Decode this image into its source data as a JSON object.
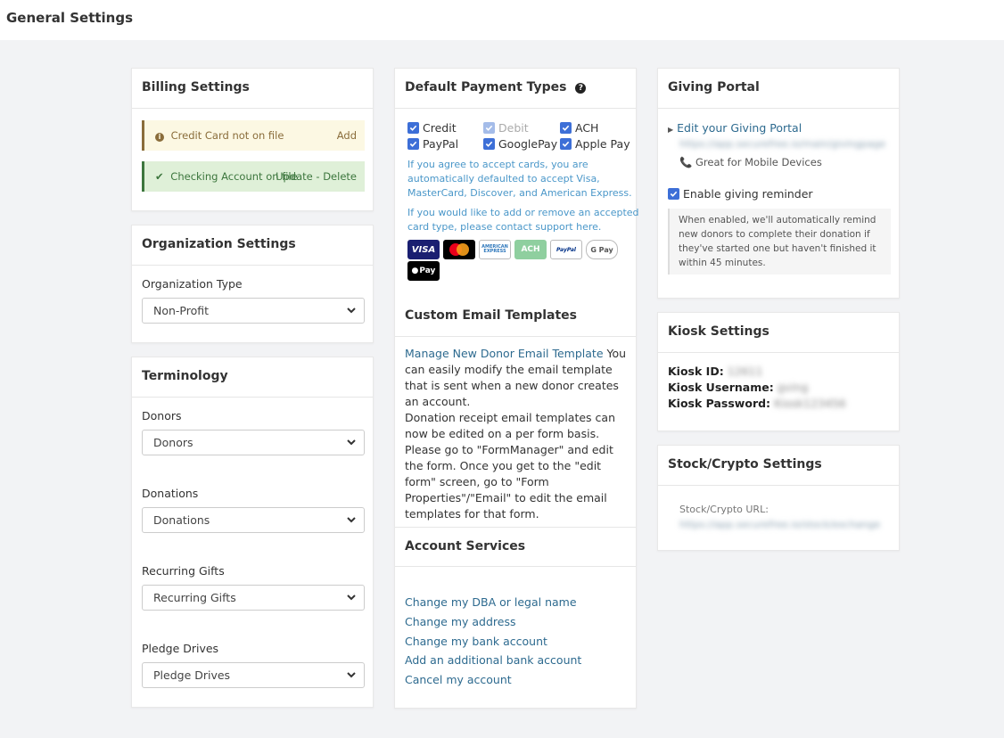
{
  "page": {
    "title": "General Settings"
  },
  "billing": {
    "title": "Billing Settings",
    "card_status": "Credit Card not on file",
    "card_action": "Add",
    "checking_status": "Checking Account on file",
    "checking_actions": "Update - Delete"
  },
  "organization": {
    "title": "Organization Settings",
    "type_label": "Organization Type",
    "type_value": "Non-Profit"
  },
  "terminology": {
    "title": "Terminology",
    "donors_label": "Donors",
    "donors_value": "Donors",
    "donations_label": "Donations",
    "donations_value": "Donations",
    "recurring_label": "Recurring Gifts",
    "recurring_value": "Recurring Gifts",
    "pledge_label": "Pledge Drives",
    "pledge_value": "Pledge Drives"
  },
  "payment_types": {
    "title": "Default Payment Types",
    "options": [
      "Credit",
      "Debit",
      "ACH",
      "PayPal",
      "GooglePay",
      "Apple Pay"
    ],
    "info1": "If you agree to accept cards, you are automatically defaulted to accept Visa, MasterCard, Discover, and American Express.",
    "info2": "If you would like to add or remove an accepted card type, please contact support here.",
    "cards": [
      "VISA",
      "AMERICAN EXPRESS",
      "ACH",
      "PayPal",
      "G Pay",
      "Pay"
    ]
  },
  "email_templates": {
    "title": "Custom Email Templates",
    "link": "Manage New Donor Email Template",
    "desc": " You can easily modify the email template that is sent when a new donor creates an account.",
    "receipt_note": "Donation receipt email templates can now be edited on a per form basis. Please go to \"FormManager\" and edit the form. Once you get to the \"edit form\" screen, go to \"Form Properties\"/\"Email\" to edit the email templates for that form."
  },
  "account_services": {
    "title": "Account Services",
    "links": [
      "Change my DBA or legal name",
      "Change my address",
      "Change my bank account",
      "Add an additional bank account",
      "Cancel my account"
    ]
  },
  "giving_portal": {
    "title": "Giving Portal",
    "edit_link": "Edit your Giving Portal",
    "portal_url": "https://app.securefree.io/main/givingpage",
    "mobile_note": "Great for Mobile Devices",
    "reminder_label": "Enable giving reminder",
    "reminder_desc": "When enabled, we'll automatically remind new donors to complete their donation if they've started one but haven't finished it within 45 minutes."
  },
  "kiosk": {
    "title": "Kiosk Settings",
    "id_label": "Kiosk ID:",
    "id_value": "12611",
    "user_label": "Kiosk Username:",
    "user_value": "gving",
    "pass_label": "Kiosk Password:",
    "pass_value": "Kiosk123456"
  },
  "stock": {
    "title": "Stock/Crypto Settings",
    "url_label": "Stock/Crypto URL:",
    "url_value": "https://app.securefree.io/stock/exchange"
  },
  "colors": {
    "accent": "#3d6fd7",
    "link": "#2d6a8f",
    "info": "#4a97c9"
  }
}
